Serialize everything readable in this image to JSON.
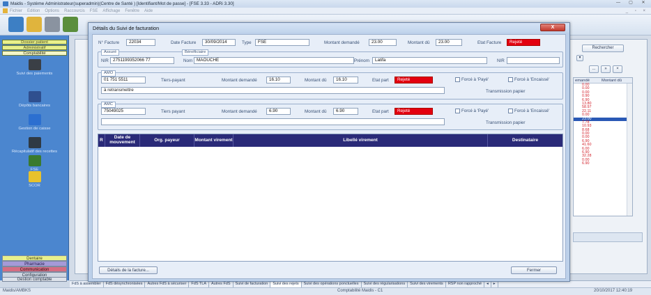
{
  "window": {
    "title": "Maidis - Système Administrateur(superadmin)(Centre de Santé ) [Identifiant/Mot de passe] - [FSE 3.33 - ADRi 3.30]",
    "controls": [
      "—",
      "▢",
      "✕"
    ]
  },
  "menu": {
    "items": [
      "Fichier",
      "Edition",
      "Options",
      "Raccourcis",
      "FSE",
      "Affichage",
      "Fenêtre",
      "Aide"
    ],
    "mdi_controls": "_ ▫ ×"
  },
  "left_nav": {
    "headers": [
      "Dossier patient",
      "Administratif",
      "Comptabilité"
    ],
    "items": [
      {
        "label": "Suivi des paiements",
        "icon": "payments-icon",
        "color": "#3a3f46"
      },
      {
        "label": "Dépôts bancaires",
        "icon": "bank-deposit-icon",
        "color": "#2f4f8f"
      },
      {
        "label": "Gestion de caisse",
        "icon": "cash-register-icon",
        "color": "#2c6fd0"
      },
      {
        "label": "Récapitulatif des recettes",
        "icon": "recipes-summary-icon",
        "color": "#2f3a44"
      },
      {
        "label": "FSE",
        "icon": "fse-icon",
        "color": "#3a7a2e"
      },
      {
        "label": "SCOR",
        "icon": "scor-icon",
        "color": "#e8c22c"
      }
    ],
    "bottom": [
      "Dentaire",
      "Pharmacie",
      "Communication",
      "Configuration",
      "Gestion comptable"
    ]
  },
  "background": {
    "search_button": "Rechercher",
    "dropdown_arrow": "▾",
    "nav_buttons": [
      "...",
      "»",
      "×"
    ],
    "list": {
      "headers": [
        "emandé",
        "Montant dû"
      ],
      "rows": [
        "0.00",
        "0.00",
        "0.00",
        "0.90",
        "6.90",
        "13.80",
        "58.97",
        "22.11",
        "0.00",
        "23.00",
        "7.78",
        "10.93",
        "8.68",
        "0.00",
        "0.00",
        "6.90",
        "41.60",
        "6.00",
        "6.90",
        "32.28",
        "0.00",
        "6.90"
      ],
      "selected_index": 9
    }
  },
  "modal": {
    "title": "Détails du Suivi de facturation",
    "close": "X",
    "facture": {
      "num_label": "N° Facture",
      "num": "22034",
      "date_label": "Date Facture",
      "date": "30/09/2014",
      "type_label": "Type",
      "type": "FSE",
      "montant_demande_label": "Montant demandé",
      "montant_demande": "23.00",
      "montant_du_label": "Montant dû",
      "montant_du": "23.00",
      "etat_label": "Etat Facture",
      "etat": "Rejeté"
    },
    "assure": {
      "group": "Assuré",
      "nir_label": "NIR",
      "nir": "2751199352066 77",
      "nom_label": "Nom",
      "nom": "MAOUCHE",
      "prenom_label": "Prénom",
      "prenom": "Latifa",
      "nir2_label": "NIR",
      "beneficiaire": "Bénéficiaire"
    },
    "amo": {
      "group": "AMO",
      "code": "01 751 5511",
      "tiers": "Tiers-payant",
      "montant_demande_label": "Montant demandé",
      "montant_demande": "16.10",
      "montant_du_label": "Montant dû",
      "montant_du": "16.10",
      "etat_label": "Etat part",
      "etat": "Rejeté",
      "force_paye": "Forcé à 'Payé'",
      "force_encaisse": "Forcé à 'Encaissé'",
      "note": "à retransmettre",
      "transmission": "Transmission papier"
    },
    "amc": {
      "group": "AMC",
      "code": "75049025",
      "tiers": "Tiers payant",
      "montant_demande_label": "Montant demandé",
      "montant_demande": "6.90",
      "montant_du_label": "Montant dû",
      "montant_du": "6.90",
      "etat_label": "Etat part",
      "etat": "Rejeté",
      "force_paye": "Forcé à 'Payé'",
      "force_encaisse": "Forcé à 'Encaissé'",
      "transmission": "Transmission papier"
    },
    "grid": {
      "corner": "R",
      "columns": [
        "Date de mouvement",
        "Org. payeur",
        "Montant virement",
        "Libellé virement",
        "Destinataire"
      ]
    },
    "buttons": {
      "details": "Détails de la facture...",
      "close": "Fermer"
    }
  },
  "tabs": [
    "FdS à assembler",
    "FdS désynchronisées",
    "Autres FdS à sécuriser",
    "FdS TLA",
    "Autres FdS",
    "Suivi de facturation",
    "Suivi des rejets",
    "Suivi des opérations ponctuelles",
    "Suivi des régularisations",
    "Suivi des virements",
    "RSP non rapproché"
  ],
  "tab_scroll": [
    "◂",
    "▸"
  ],
  "active_tab": 6,
  "status": {
    "left": "Maidis/AMBKS",
    "center": "Comptabilité Maidis - C1",
    "right": "20/10/2017 12:40:19"
  }
}
